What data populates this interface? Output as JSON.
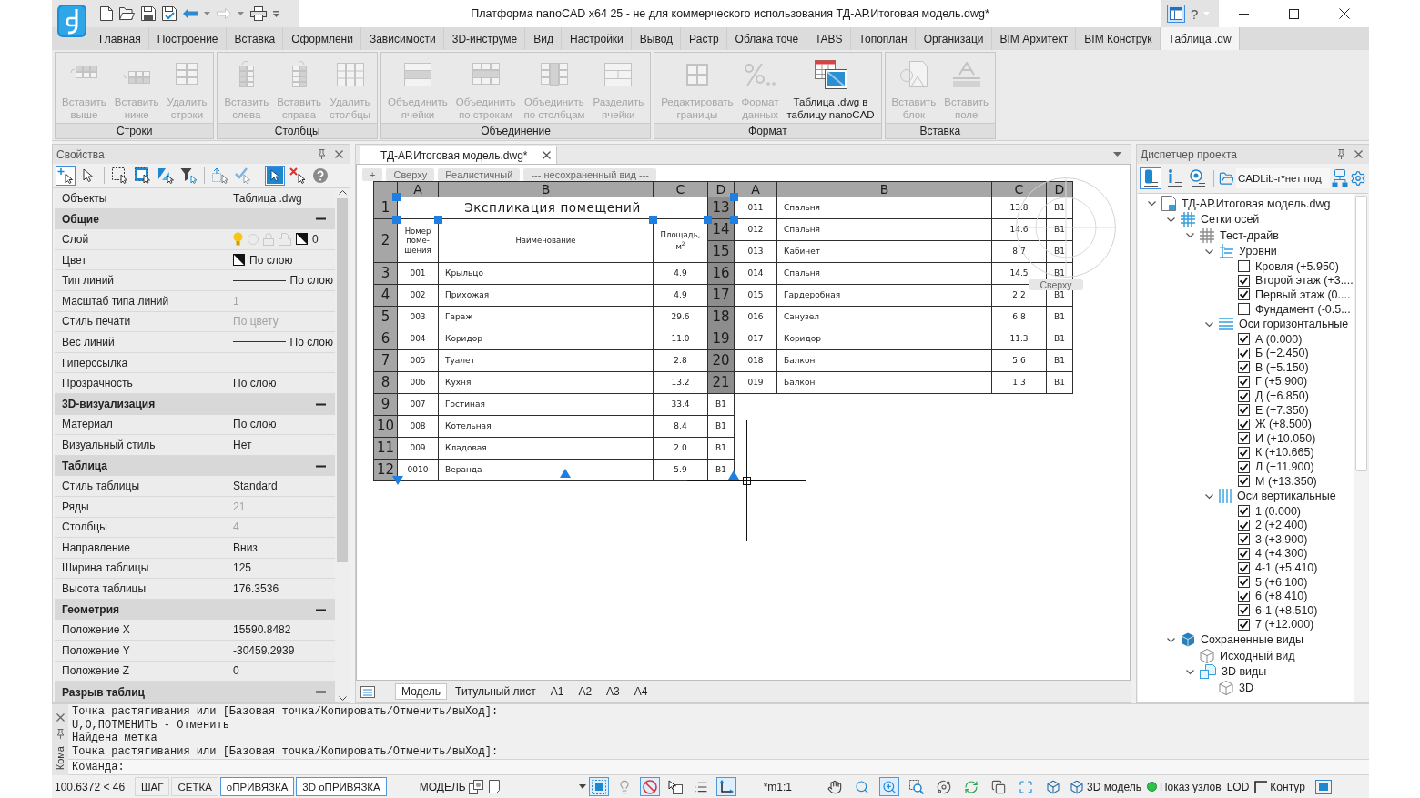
{
  "title_bar": {
    "title": "Платформа nanoCAD x64 25 - не для коммерческого использования ТД-АР.Итоговая модель.dwg*",
    "help": "?"
  },
  "ribbon": {
    "tabs": [
      {
        "label": "Главная",
        "selected": false
      },
      {
        "label": "Построение",
        "selected": false
      },
      {
        "label": "Вставка",
        "selected": false
      },
      {
        "label": "Оформлени",
        "selected": false
      },
      {
        "label": "Зависимости",
        "selected": false
      },
      {
        "label": "3D-инструме",
        "selected": false
      },
      {
        "label": "Вид",
        "selected": false
      },
      {
        "label": "Настройки",
        "selected": false
      },
      {
        "label": "Вывод",
        "selected": false
      },
      {
        "label": "Растр",
        "selected": false
      },
      {
        "label": "Облака точе",
        "selected": false
      },
      {
        "label": "TABS",
        "selected": false
      },
      {
        "label": "Топоплан",
        "selected": false
      },
      {
        "label": "Организаци",
        "selected": false
      },
      {
        "label": "BIM Архитект",
        "selected": false
      },
      {
        "label": "BIM Конструк",
        "selected": false
      },
      {
        "label": "Таблица .dw",
        "selected": true
      }
    ],
    "panels": [
      {
        "title": "Строки",
        "buttons": [
          {
            "label": "Вставить\nвыше",
            "disabled": true
          },
          {
            "label": "Вставить\nниже",
            "disabled": true
          },
          {
            "label": "Удалить\nстроки",
            "disabled": true
          }
        ]
      },
      {
        "title": "Столбцы",
        "buttons": [
          {
            "label": "Вставить\nслева",
            "disabled": true
          },
          {
            "label": "Вставить\nсправа",
            "disabled": true
          },
          {
            "label": "Удалить\nстолбцы",
            "disabled": true
          }
        ]
      },
      {
        "title": "Объединение",
        "buttons": [
          {
            "label": "Объединить\nячейки",
            "disabled": true
          },
          {
            "label": "Объединить\nпо строкам",
            "disabled": true
          },
          {
            "label": "Объединить\nпо столбцам",
            "disabled": true
          },
          {
            "label": "Разделить\nячейки",
            "disabled": true
          }
        ]
      },
      {
        "title": "Формат",
        "buttons": [
          {
            "label": "Редактировать\nграницы",
            "disabled": true
          },
          {
            "label": "Формат\nданных",
            "disabled": true
          },
          {
            "label": "Таблица .dwg в\nтаблицу nanoCAD",
            "disabled": false
          }
        ]
      },
      {
        "title": "Вставка",
        "buttons": [
          {
            "label": "Вставить\nблок",
            "disabled": true
          },
          {
            "label": "Вставить\nполе",
            "disabled": true
          }
        ]
      }
    ]
  },
  "properties": {
    "title": "Свойства",
    "tools": [
      {
        "selected": true
      },
      {
        "selected": false
      },
      {
        "selected": false
      },
      {
        "selected": false
      },
      {
        "selected": false
      },
      {
        "selected": false
      },
      {
        "selected": false
      },
      {
        "selected": false
      },
      {
        "selected": true
      },
      {
        "selected": false
      },
      {
        "selected": false
      }
    ],
    "rows": [
      {
        "kind": "text",
        "label": "Объекты",
        "value": "Таблица .dwg",
        "dimmed": false
      },
      {
        "kind": "section",
        "label": "Общие",
        "expanded": true
      },
      {
        "kind": "layer",
        "label": "Слой",
        "value": "0",
        "dimmed": false
      },
      {
        "kind": "swatch",
        "label": "Цвет",
        "value": "По слою",
        "dimmed": false
      },
      {
        "kind": "line",
        "label": "Тип линий",
        "value": "По слою",
        "dimmed": false
      },
      {
        "kind": "text",
        "label": "Масштаб типа линий",
        "value": "1",
        "dimmed": true
      },
      {
        "kind": "text",
        "label": "Стиль печати",
        "value": "По цвету",
        "dimmed": true
      },
      {
        "kind": "line",
        "label": "Вес линий",
        "value": "По слою",
        "dimmed": false
      },
      {
        "kind": "text",
        "label": "Гиперссылка"
      },
      {
        "kind": "text",
        "label": "Прозрачность",
        "value": "По слою",
        "dimmed": false
      },
      {
        "kind": "section",
        "label": "3D-визуализация",
        "expanded": true
      },
      {
        "kind": "text",
        "label": "Материал",
        "value": "По слою",
        "dimmed": false
      },
      {
        "kind": "text",
        "label": "Визуальный стиль",
        "value": "Нет",
        "dimmed": false
      },
      {
        "kind": "section",
        "label": "Таблица",
        "expanded": true
      },
      {
        "kind": "text",
        "label": "Стиль таблицы",
        "value": "Standard",
        "dimmed": false
      },
      {
        "kind": "text",
        "label": "Ряды",
        "value": "21",
        "dimmed": true
      },
      {
        "kind": "text",
        "label": "Столбцы",
        "value": "4",
        "dimmed": true
      },
      {
        "kind": "text",
        "label": "Направление",
        "value": "Вниз",
        "dimmed": false
      },
      {
        "kind": "text",
        "label": "Ширина таблицы",
        "value": "125",
        "dimmed": false
      },
      {
        "kind": "text",
        "label": "Высота таблицы",
        "value": "176.3536",
        "dimmed": false
      },
      {
        "kind": "section",
        "label": "Геометрия",
        "expanded": true
      },
      {
        "kind": "text",
        "label": "Положение X",
        "value": "15590.8482",
        "dimmed": false
      },
      {
        "kind": "text",
        "label": "Положение Y",
        "value": "-30459.2939",
        "dimmed": false
      },
      {
        "kind": "text",
        "label": "Положение Z",
        "value": "0",
        "dimmed": false
      },
      {
        "kind": "section",
        "label": "Разрыв таблиц",
        "expanded": true
      }
    ]
  },
  "document": {
    "tab": "ТД-АР.Итоговая модель.dwg*",
    "view_controls": [
      "+",
      "Сверху",
      "Реалистичный",
      "--- несохраненный вид ---"
    ],
    "compass_label": "Сверху",
    "drawing": {
      "left_table": {
        "columns": [
          "A",
          "B",
          "C",
          "D"
        ],
        "rows": [
          {
            "number": "1",
            "kind": "title",
            "cells": [
              "Экспликация помещений"
            ]
          },
          {
            "number": "2",
            "kind": "header",
            "cells": [
              "Номер поме-щения",
              "Наименование",
              "Площадь, м$^{2}$"
            ]
          },
          {
            "number": "3",
            "kind": "data",
            "cells": [
              "001",
              "Крыльцо",
              "4.9"
            ]
          },
          {
            "number": "4",
            "kind": "data",
            "cells": [
              "002",
              "Прихожая",
              "4.9"
            ]
          },
          {
            "number": "5",
            "kind": "data",
            "cells": [
              "003",
              "Гараж",
              "29.6"
            ]
          },
          {
            "number": "6",
            "kind": "data",
            "cells": [
              "004",
              "Коридор",
              "11.0"
            ]
          },
          {
            "number": "7",
            "kind": "data",
            "cells": [
              "005",
              "Туалет",
              "2.8"
            ]
          },
          {
            "number": "8",
            "kind": "data",
            "cells": [
              "006",
              "Кухня",
              "13.2"
            ]
          },
          {
            "number": "9",
            "kind": "data",
            "cells": [
              "007",
              "Гостиная",
              "33.4",
              "В1"
            ]
          },
          {
            "number": "10",
            "kind": "data",
            "cells": [
              "008",
              "Котельная",
              "8.4",
              "В1"
            ]
          },
          {
            "number": "11",
            "kind": "data",
            "cells": [
              "009",
              "Кладовая",
              "2.0",
              "В1"
            ]
          },
          {
            "number": "12",
            "kind": "data",
            "cells": [
              "0010",
              "Веранда",
              "5.9",
              "В1"
            ]
          }
        ]
      },
      "right_table": {
        "columns": [
          "A",
          "B",
          "C",
          "D"
        ],
        "rows": [
          {
            "number": "13",
            "cells": [
              "011",
              "Спальня",
              "13.8",
              "В1"
            ]
          },
          {
            "number": "14",
            "cells": [
              "012",
              "Спальня",
              "14.6",
              "В1"
            ]
          },
          {
            "number": "15",
            "cells": [
              "013",
              "Кабинет",
              "8.7",
              "В1"
            ]
          },
          {
            "number": "16",
            "cells": [
              "014",
              "Спальня",
              "14.5",
              "В1"
            ]
          },
          {
            "number": "17",
            "cells": [
              "015",
              "Гардеробная",
              "2.2",
              "В1"
            ]
          },
          {
            "number": "18",
            "cells": [
              "016",
              "Санузел",
              "6.8",
              "В1"
            ]
          },
          {
            "number": "19",
            "cells": [
              "017",
              "Коридор",
              "11.3",
              "В1"
            ]
          },
          {
            "number": "20",
            "cells": [
              "018",
              "Балкон",
              "5.6",
              "В1"
            ]
          },
          {
            "number": "21",
            "cells": [
              "019",
              "Балкон",
              "1.3",
              "В1"
            ]
          }
        ]
      }
    },
    "layout_tabs": [
      {
        "label": "Модель",
        "selected": true
      },
      {
        "label": "Титульный лист",
        "selected": false
      },
      {
        "label": "A1",
        "selected": false
      },
      {
        "label": "A2",
        "selected": false
      },
      {
        "label": "A3",
        "selected": false
      },
      {
        "label": "A4",
        "selected": false
      }
    ]
  },
  "project_manager": {
    "title": "Диспетчер проекта",
    "tools": [
      {
        "selected": true
      },
      {
        "selected": false
      },
      {
        "selected": false
      }
    ],
    "database": "CADLib-r*нет под",
    "tree": [
      {
        "kind": "file",
        "label": "ТД-АР.Итоговая модель.dwg",
        "expanded": true,
        "children": [
          {
            "kind": "grid_set",
            "label": "Сетки осей",
            "expanded": true,
            "children": [
              {
                "kind": "grid",
                "label": "Тест-драйв",
                "expanded": true,
                "children": [
                  {
                    "kind": "levels",
                    "label": "Уровни",
                    "expanded": true,
                    "children": [
                      {
                        "kind": "item",
                        "label": "Кровля (+5.950)",
                        "checked": false
                      },
                      {
                        "kind": "item",
                        "label": "Второй этаж (+3....",
                        "checked": true
                      },
                      {
                        "kind": "item",
                        "label": "Первый этаж (0....",
                        "checked": true
                      },
                      {
                        "kind": "item",
                        "label": "Фундамент (-0.5...",
                        "checked": false
                      }
                    ]
                  },
                  {
                    "kind": "axes_horizontal",
                    "label": "Оси горизонтальные",
                    "expanded": true,
                    "children": [
                      {
                        "kind": "item",
                        "label": "А (0.000)",
                        "checked": true
                      },
                      {
                        "kind": "item",
                        "label": "Б (+2.450)",
                        "checked": true
                      },
                      {
                        "kind": "item",
                        "label": "В (+5.150)",
                        "checked": true
                      },
                      {
                        "kind": "item",
                        "label": "Г (+5.900)",
                        "checked": true
                      },
                      {
                        "kind": "item",
                        "label": "Д (+6.850)",
                        "checked": true
                      },
                      {
                        "kind": "item",
                        "label": "Е (+7.350)",
                        "checked": true
                      },
                      {
                        "kind": "item",
                        "label": "Ж (+8.500)",
                        "checked": true
                      },
                      {
                        "kind": "item",
                        "label": "И (+10.050)",
                        "checked": true
                      },
                      {
                        "kind": "item",
                        "label": "К (+10.665)",
                        "checked": true
                      },
                      {
                        "kind": "item",
                        "label": "Л (+11.900)",
                        "checked": true
                      },
                      {
                        "kind": "item",
                        "label": "М (+13.350)",
                        "checked": true
                      }
                    ]
                  },
                  {
                    "kind": "axes_vertical",
                    "label": "Оси вертикальные",
                    "expanded": true,
                    "children": [
                      {
                        "kind": "item",
                        "label": "1 (0.000)",
                        "checked": true
                      },
                      {
                        "kind": "item",
                        "label": "2 (+2.400)",
                        "checked": true
                      },
                      {
                        "kind": "item",
                        "label": "3 (+3.900)",
                        "checked": true
                      },
                      {
                        "kind": "item",
                        "label": "4 (+4.300)",
                        "checked": true
                      },
                      {
                        "kind": "item",
                        "label": "4-1 (+5.410)",
                        "checked": true
                      },
                      {
                        "kind": "item",
                        "label": "5 (+6.100)",
                        "checked": true
                      },
                      {
                        "kind": "item",
                        "label": "6 (+8.410)",
                        "checked": true
                      },
                      {
                        "kind": "item",
                        "label": "6-1 (+8.510)",
                        "checked": true
                      },
                      {
                        "kind": "item",
                        "label": "7 (+12.000)",
                        "checked": true
                      }
                    ]
                  }
                ]
              }
            ]
          },
          {
            "kind": "views",
            "label": "Сохраненные виды",
            "expanded": true,
            "children": [
              {
                "kind": "view",
                "label": "Исходный вид"
              },
              {
                "kind": "view_group",
                "label": "3D виды",
                "expanded": true,
                "children": [
                  {
                    "kind": "view",
                    "label": "3D"
                  }
                ]
              }
            ]
          }
        ]
      }
    ]
  },
  "command_line": {
    "caption": "Кома",
    "history": [
      "Точка растягивания или [Базовая точка/Копировать/Отменить/выХод]:",
      "U,O,ПОТМЕНИТЬ - Отменить",
      "Найдена метка",
      "Точка растягивания или [Базовая точка/Копировать/Отменить/выХод]:"
    ],
    "prompt": "Команда:"
  },
  "status_bar": {
    "coordinates": "100.6372 < 46",
    "modes": [
      {
        "label": "ШАГ",
        "on": false
      },
      {
        "label": "СЕТКА",
        "on": false
      },
      {
        "label": "оПРИВЯЗКА",
        "on": true
      },
      {
        "label": "3D оПРИВЯЗКА",
        "on": true
      }
    ],
    "space": "МОДЕЛЬ",
    "tools": [
      {
        "on": true
      },
      {
        "on": false
      },
      {
        "on": true
      },
      {
        "on": false
      },
      {
        "on": false
      },
      {
        "on": true
      }
    ],
    "scale": "*m1:1",
    "view_tools": [
      {
        "on": false
      },
      {
        "on": false
      },
      {
        "on": true
      },
      {
        "on": false
      },
      {
        "on": false
      },
      {
        "on": false
      },
      {
        "on": false
      },
      {
        "on": false
      },
      {
        "on": false
      }
    ],
    "model_mode": "3D модель",
    "nodes": "Показ узлов",
    "lod": "LOD",
    "contour": "Контур"
  }
}
